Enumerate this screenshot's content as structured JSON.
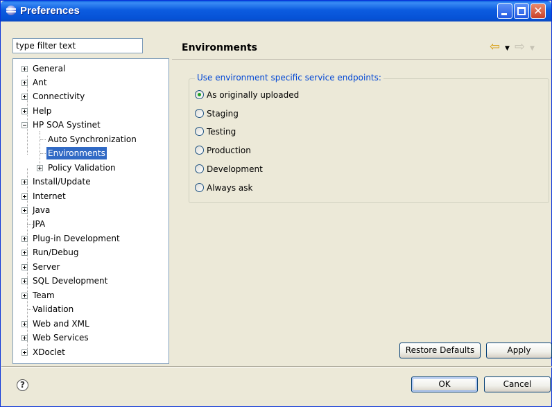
{
  "window": {
    "title": "Preferences",
    "minimize_icon": "minimize-icon",
    "maximize_icon": "maximize-icon",
    "close_icon": "close-icon"
  },
  "filter": {
    "value": "type filter text"
  },
  "tree": {
    "items": [
      {
        "label": "General",
        "expander": "plus",
        "level": 0
      },
      {
        "label": "Ant",
        "expander": "plus",
        "level": 0
      },
      {
        "label": "Connectivity",
        "expander": "plus",
        "level": 0
      },
      {
        "label": "Help",
        "expander": "plus",
        "level": 0
      },
      {
        "label": "HP SOA Systinet",
        "expander": "minus",
        "level": 0
      },
      {
        "label": "Auto Synchronization",
        "expander": "none",
        "level": 1
      },
      {
        "label": "Environments",
        "expander": "none",
        "level": 1,
        "selected": true
      },
      {
        "label": "Policy Validation",
        "expander": "plus",
        "level": 1
      },
      {
        "label": "Install/Update",
        "expander": "plus",
        "level": 0
      },
      {
        "label": "Internet",
        "expander": "plus",
        "level": 0
      },
      {
        "label": "Java",
        "expander": "plus",
        "level": 0
      },
      {
        "label": "JPA",
        "expander": "none",
        "level": 0
      },
      {
        "label": "Plug-in Development",
        "expander": "plus",
        "level": 0
      },
      {
        "label": "Run/Debug",
        "expander": "plus",
        "level": 0
      },
      {
        "label": "Server",
        "expander": "plus",
        "level": 0
      },
      {
        "label": "SQL Development",
        "expander": "plus",
        "level": 0
      },
      {
        "label": "Team",
        "expander": "plus",
        "level": 0
      },
      {
        "label": "Validation",
        "expander": "none",
        "level": 0
      },
      {
        "label": "Web and XML",
        "expander": "plus",
        "level": 0
      },
      {
        "label": "Web Services",
        "expander": "plus",
        "level": 0
      },
      {
        "label": "XDoclet",
        "expander": "plus",
        "level": 0
      }
    ]
  },
  "page": {
    "title": "Environments",
    "back_icon": "back-arrow-icon",
    "forward_icon": "forward-arrow-icon"
  },
  "environment_group": {
    "legend": "Use environment specific service endpoints:",
    "options": [
      {
        "label": "As originally uploaded",
        "checked": true
      },
      {
        "label": "Staging",
        "checked": false
      },
      {
        "label": "Testing",
        "checked": false
      },
      {
        "label": "Production",
        "checked": false
      },
      {
        "label": "Development",
        "checked": false
      },
      {
        "label": "Always ask",
        "checked": false
      }
    ]
  },
  "buttons": {
    "restore_defaults": "Restore Defaults",
    "apply": "Apply",
    "ok": "OK",
    "cancel": "Cancel"
  },
  "help": {
    "icon": "help-icon",
    "glyph": "?"
  },
  "colors": {
    "title_bar": "#0a5fe0",
    "selection": "#316ac5",
    "legend_text": "#0046d5",
    "radio_checked": "#21a121"
  }
}
